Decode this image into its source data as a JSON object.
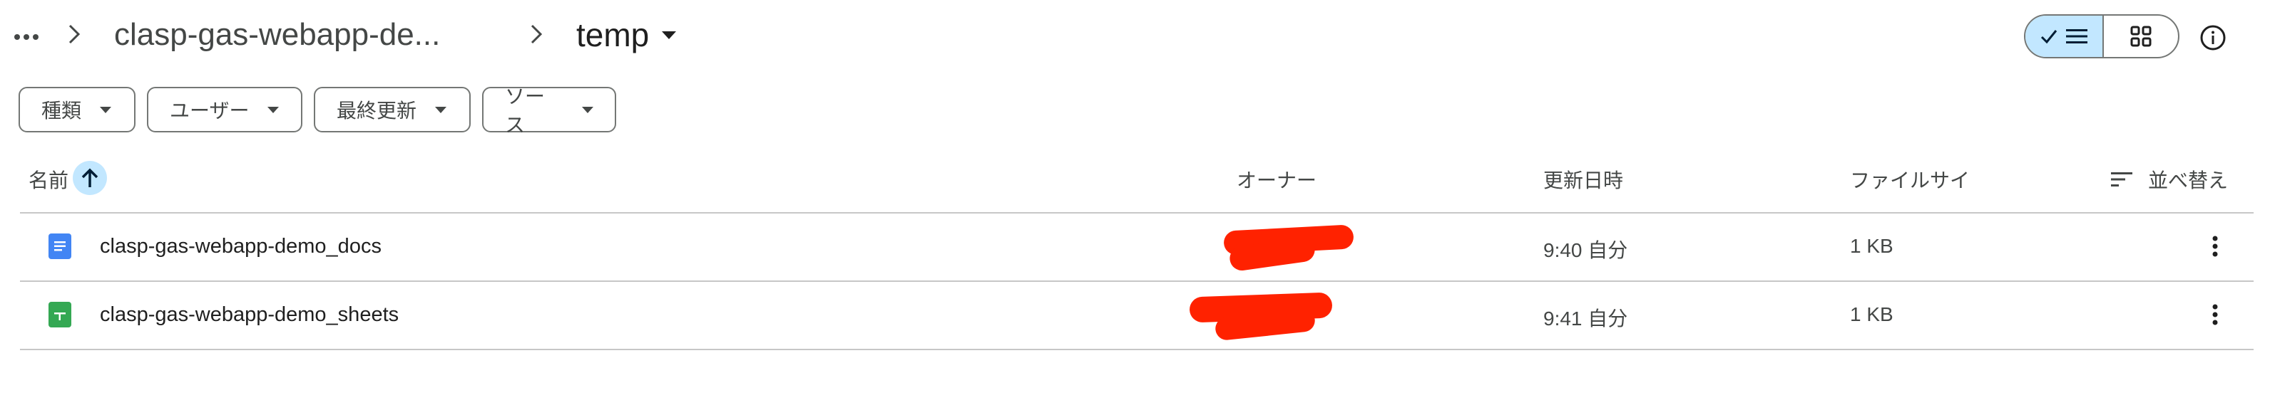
{
  "breadcrumb": {
    "more_icon": "more-horizontal-icon",
    "parent": "clasp-gas-webapp-de...",
    "current": "temp"
  },
  "view_toggle": {
    "list_icon": "check-list-icon",
    "grid_icon": "grid-icon"
  },
  "info_icon": "info-icon",
  "filters": [
    {
      "label": "種類"
    },
    {
      "label": "ユーザー"
    },
    {
      "label": "最終更新"
    },
    {
      "label": "ソース"
    }
  ],
  "columns": {
    "name": "名前",
    "owner": "オーナー",
    "modified": "更新日時",
    "size": "ファイルサイ",
    "sort": "並べ替え"
  },
  "files": [
    {
      "name": "clasp-gas-webapp-demo_docs",
      "type": "docs",
      "icon_color": "#4285f4",
      "modified": "9:40 自分",
      "size": "1 KB"
    },
    {
      "name": "clasp-gas-webapp-demo_sheets",
      "type": "sheets",
      "icon_color": "#34a853",
      "modified": "9:41 自分",
      "size": "1 KB"
    }
  ],
  "colors": {
    "accent": "#c2e7ff",
    "redaction": "#ff2200",
    "border": "#747775"
  }
}
